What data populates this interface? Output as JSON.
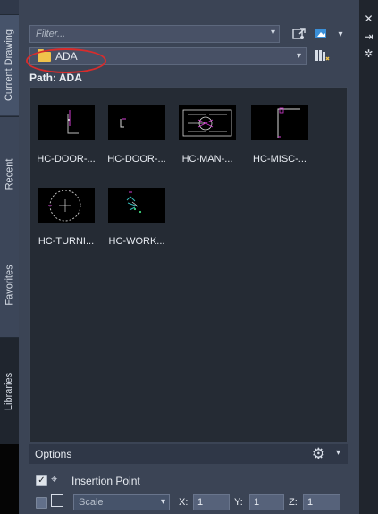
{
  "sidebar": {
    "tabs": [
      {
        "label": "Current Drawing"
      },
      {
        "label": "Recent"
      },
      {
        "label": "Favorites"
      },
      {
        "label": "Libraries"
      }
    ]
  },
  "filter": {
    "placeholder": "Filter..."
  },
  "folder_select": {
    "label": "ADA"
  },
  "path": {
    "text": "Path: ADA"
  },
  "blocks": [
    {
      "label": "HC-DOOR-..."
    },
    {
      "label": "HC-DOOR-..."
    },
    {
      "label": "HC-MAN-..."
    },
    {
      "label": "HC-MISC-..."
    },
    {
      "label": "HC-TURNI..."
    },
    {
      "label": "HC-WORK..."
    }
  ],
  "options": {
    "title": "Options",
    "insertion_point_label": "Insertion Point",
    "scale_label": "Scale",
    "x_label": "X:",
    "x_value": "1",
    "y_label": "Y:",
    "y_value": "1",
    "z_label": "Z:",
    "z_value": "1"
  },
  "icons": {
    "close": "close-icon",
    "pin": "pin-icon",
    "settings": "settings-icon",
    "import": "import-icon",
    "view": "view-icon",
    "library": "library-icon",
    "gear": "gear-icon"
  }
}
